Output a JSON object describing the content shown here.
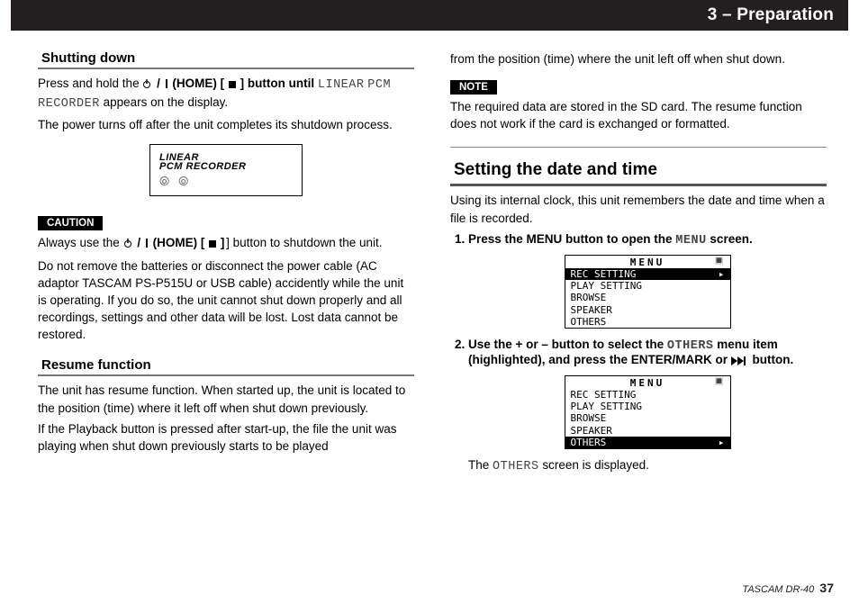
{
  "chapter": "3 – Preparation",
  "left": {
    "sec1_title": "Shutting down",
    "sec1_p1a": "Press and hold the ",
    "sec1_p1b": "(HOME) [",
    "sec1_p1c": "] button until ",
    "lcd_linear": "LINEAR",
    "lcd_pcmrec": "PCM RECORDER",
    "sec1_p1d": " appears on the display.",
    "sec1_p2": "The power turns off after the unit completes its shutdown process.",
    "caution_label": "CAUTION",
    "caution_p1a": "Always use the ",
    "caution_p1b": "(HOME) [",
    "caution_p1c": "] button to shutdown the unit.",
    "caution_p2": "Do not remove the batteries or disconnect the power cable (AC adaptor TASCAM PS-P515U or USB cable) accidently while the unit is operating. If you do so, the unit cannot shut down properly and all recordings, settings and other data will be lost. Lost data cannot be restored.",
    "sec2_title": "Resume function",
    "sec2_p1": "The unit has resume function. When started up, the unit is located to the position (time) where it left off when shut down previously.",
    "sec2_p2": "If the Playback button is pressed after start-up, the file the unit was playing when shut down previously starts to be played"
  },
  "right": {
    "cont_p": "from the position (time) where the unit left off when shut down.",
    "note_label": "NOTE",
    "note_p": "The required data are stored in the SD card. The resume function does not work if the card is exchanged or formatted.",
    "sec3_title": "Setting the date and time",
    "sec3_intro": "Using its internal clock, this unit remembers the date and time when a file is recorded.",
    "step1a": "Press the MENU button to open the ",
    "step1_menu": "MENU",
    "step1b": " screen.",
    "menu_title": "MENU",
    "menu_items": [
      "REC SETTING",
      "PLAY SETTING",
      "BROWSE",
      "SPEAKER",
      "OTHERS"
    ],
    "step2a": "Use the + or – button to select the ",
    "step2_others": "OTHERS",
    "step2b": " menu item (highlighted), and press the ENTER/MARK or ",
    "step2c": " button.",
    "after_step2a": "The ",
    "after_step2_others": "OTHERS",
    "after_step2b": " screen is displayed."
  },
  "footer_model": "TASCAM DR-40",
  "footer_page": "37"
}
